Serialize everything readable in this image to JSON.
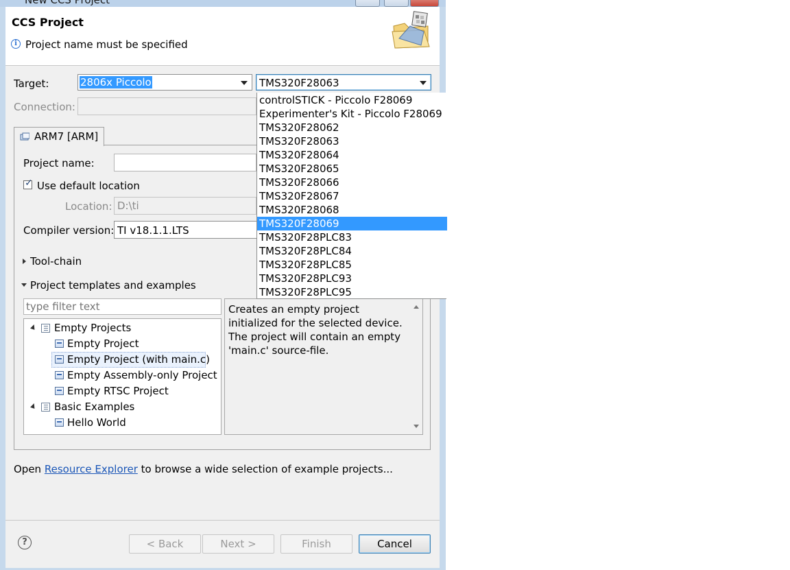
{
  "window": {
    "title": "New CCS Project"
  },
  "banner": {
    "title": "CCS Project",
    "message": "Project name must be specified"
  },
  "target": {
    "label": "Target:",
    "family_value": "2806x Piccolo",
    "device_value": "TMS320F28063"
  },
  "connection": {
    "label": "Connection:"
  },
  "device_dropdown": {
    "items": [
      "controlSTICK - Piccolo F28069",
      "Experimenter's Kit - Piccolo F28069",
      "TMS320F28062",
      "TMS320F28063",
      "TMS320F28064",
      "TMS320F28065",
      "TMS320F28066",
      "TMS320F28067",
      "TMS320F28068",
      "TMS320F28069",
      "TMS320F28PLC83",
      "TMS320F28PLC84",
      "TMS320F28PLC85",
      "TMS320F28PLC93",
      "TMS320F28PLC95"
    ],
    "highlighted": "TMS320F28069"
  },
  "tab": {
    "label": "ARM7 [ARM]"
  },
  "form": {
    "project_name_label": "Project name:",
    "project_name_value": "",
    "use_default_location_label": "Use default location",
    "use_default_location_checked": true,
    "location_label": "Location:",
    "location_value": "D:\\ti",
    "compiler_label": "Compiler version:",
    "compiler_value": "TI v18.1.1.LTS",
    "toolchain_label": "Tool-chain",
    "templates_label": "Project templates and examples"
  },
  "templates": {
    "filter_placeholder": "type filter text",
    "tree": [
      {
        "label": "Empty Projects",
        "type": "folder",
        "level": 0
      },
      {
        "label": "Empty Project",
        "type": "project",
        "level": 1
      },
      {
        "label": "Empty Project (with main.c)",
        "type": "project",
        "level": 1,
        "selected": true
      },
      {
        "label": "Empty Assembly-only Project",
        "type": "project",
        "level": 1
      },
      {
        "label": "Empty RTSC Project",
        "type": "project",
        "level": 1
      },
      {
        "label": "Basic Examples",
        "type": "folder",
        "level": 0
      },
      {
        "label": "Hello World",
        "type": "project",
        "level": 1
      }
    ],
    "description": "Creates an empty project initialized for the selected device. The project will contain an empty 'main.c' source-file."
  },
  "footer_text": {
    "prefix": "Open ",
    "link": "Resource Explorer",
    "suffix": " to browse a wide selection of example projects..."
  },
  "buttons": {
    "back": "< Back",
    "next": "Next >",
    "finish": "Finish",
    "cancel": "Cancel"
  }
}
